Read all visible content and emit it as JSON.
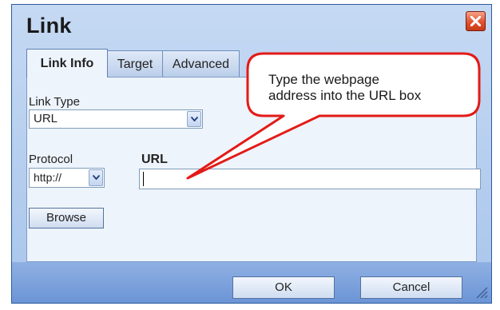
{
  "dialog": {
    "title": "Link",
    "tabs": [
      {
        "label": "Link Info",
        "active": true
      },
      {
        "label": "Target",
        "active": false
      },
      {
        "label": "Advanced",
        "active": false
      }
    ],
    "link_type_label": "Link Type",
    "link_type_value": "URL",
    "protocol_label": "Protocol",
    "protocol_value": "http://",
    "url_label": "URL",
    "url_value": "",
    "browse_label": "Browse",
    "ok_label": "OK",
    "cancel_label": "Cancel"
  },
  "callout": {
    "line1": "Type the webpage",
    "line2": "address into the URL box"
  },
  "colors": {
    "callout_stroke": "#e31b17",
    "close_button": "#e2512d",
    "dialog_bg": "#c5d9f3",
    "footer_bar": "#7aa0dc"
  },
  "icons": [
    "close-icon",
    "chevron-down-icon",
    "resize-grip-icon"
  ]
}
